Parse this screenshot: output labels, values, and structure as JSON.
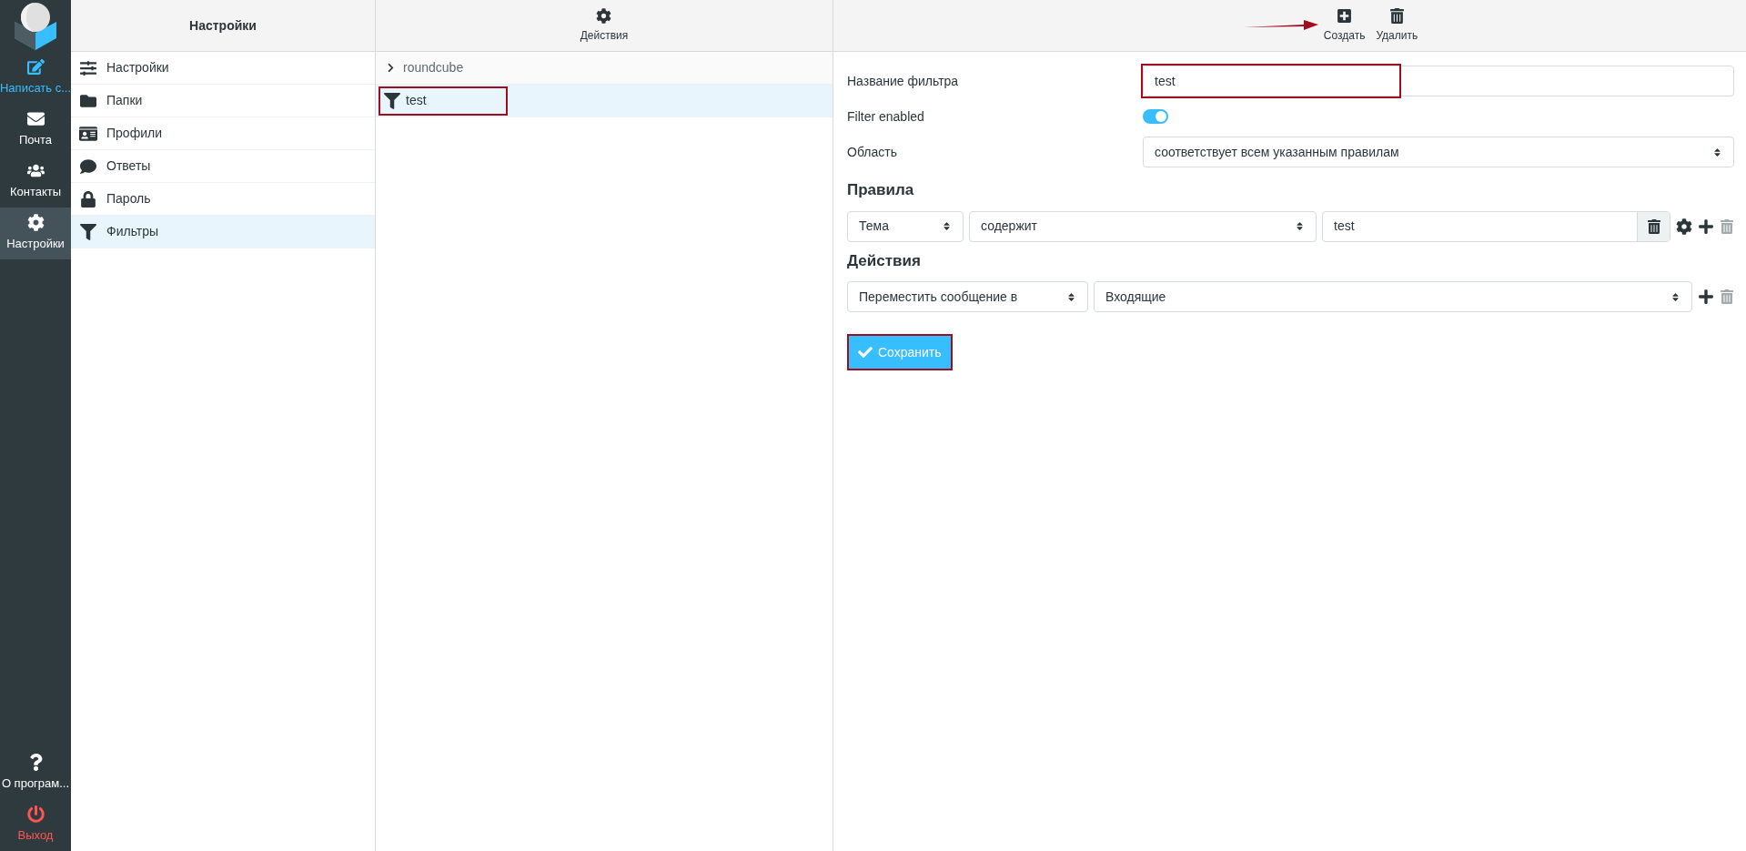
{
  "nav": {
    "items": [
      {
        "label": "Написать с...",
        "kind": "accent",
        "selected": false
      },
      {
        "label": "Почта",
        "kind": "plain",
        "selected": false
      },
      {
        "label": "Контакты",
        "kind": "plain",
        "selected": false
      },
      {
        "label": "Настройки",
        "kind": "plain",
        "selected": true
      }
    ],
    "bottom_items": [
      {
        "label": "О програм...",
        "kind": "plain"
      },
      {
        "label": "Выход",
        "kind": "danger"
      }
    ]
  },
  "settings": {
    "title": "Настройки",
    "items": [
      {
        "label": "Настройки",
        "selected": false
      },
      {
        "label": "Папки",
        "selected": false
      },
      {
        "label": "Профили",
        "selected": false
      },
      {
        "label": "Ответы",
        "selected": false
      },
      {
        "label": "Пароль",
        "selected": false
      },
      {
        "label": "Фильтры",
        "selected": true
      }
    ]
  },
  "filters": {
    "toolbar_button": "Действия",
    "items": [
      {
        "label": "roundcube",
        "kind": "set",
        "selected": false,
        "annotated": false
      },
      {
        "label": "test",
        "kind": "filter",
        "selected": true,
        "annotated": true
      }
    ]
  },
  "toolbar": {
    "buttons": [
      {
        "label": "Создать",
        "annotated": true
      },
      {
        "label": "Удалить",
        "annotated": false
      }
    ]
  },
  "form": {
    "name_label": "Название фильтра",
    "name_value": "test",
    "name_annotated": true,
    "enabled_label": "Filter enabled",
    "enabled": true,
    "scope_label": "Область",
    "scope_value": "соответствует всем указанным правилам",
    "rules_heading": "Правила",
    "rules": [
      {
        "field": "Тема",
        "operator": "содержит",
        "value": "test"
      }
    ],
    "actions_heading": "Действия",
    "actions": [
      {
        "action": "Переместить сообщение в",
        "target": "Входящие"
      }
    ],
    "save_label": "Сохранить",
    "save_annotated": true
  }
}
